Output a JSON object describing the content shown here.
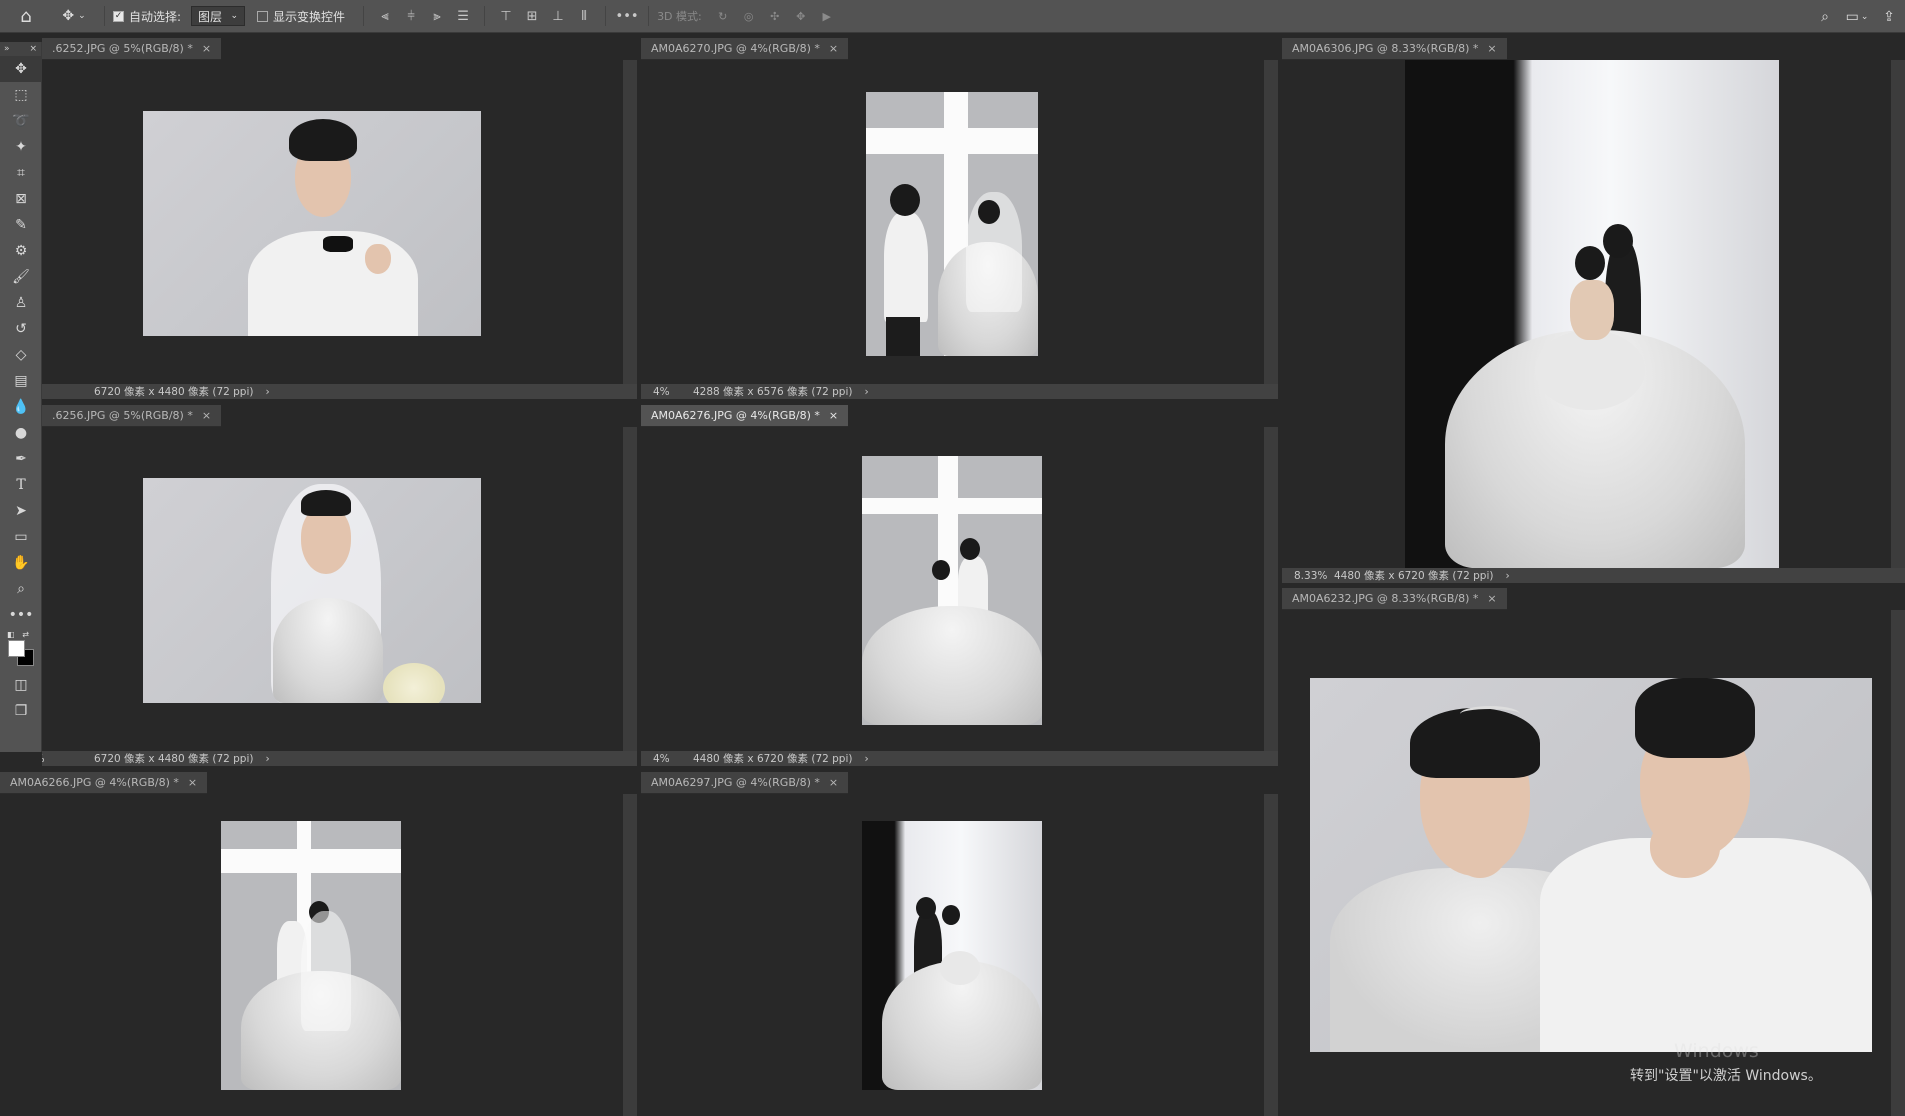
{
  "options_bar": {
    "auto_select_label": "自动选择:",
    "auto_select_target": "图层",
    "show_transform_label": "显示变换控件",
    "more_label": "•••",
    "mode_3d_label": "3D 模式:"
  },
  "toolbar": {
    "collapse_label": "»",
    "close_label": "×"
  },
  "documents": [
    {
      "tab": ".6252.JPG @ 5%(RGB/8) *",
      "zoom": "",
      "size": "6720 像素 x 4480 像素 (72 ppi)",
      "active": false
    },
    {
      "tab": "AM0A6270.JPG @ 4%(RGB/8) *",
      "zoom": "4%",
      "size": "4288 像素 x 6576 像素 (72 ppi)",
      "active": false
    },
    {
      "tab": "AM0A6306.JPG @ 8.33%(RGB/8) *",
      "zoom": "8.33%",
      "size": "4480 像素 x 6720 像素 (72 ppi)",
      "active": false
    },
    {
      "tab": ".6256.JPG @ 5%(RGB/8) *",
      "zoom": "5%",
      "size": "6720 像素 x 4480 像素 (72 ppi)",
      "active": false
    },
    {
      "tab": "AM0A6276.JPG @ 4%(RGB/8) *",
      "zoom": "4%",
      "size": "4480 像素 x 6720 像素 (72 ppi)",
      "active": true
    },
    {
      "tab": "AM0A6232.JPG @ 8.33%(RGB/8) *",
      "zoom": "",
      "size": "",
      "active": false
    },
    {
      "tab": "AM0A6266.JPG @ 4%(RGB/8) *",
      "zoom": "",
      "size": "",
      "active": false
    },
    {
      "tab": "AM0A6297.JPG @ 4%(RGB/8) *",
      "zoom": "",
      "size": "",
      "active": false
    }
  ],
  "watermark": {
    "line1": "Windows",
    "line2": "转到\"设置\"以激活 Windows。"
  }
}
